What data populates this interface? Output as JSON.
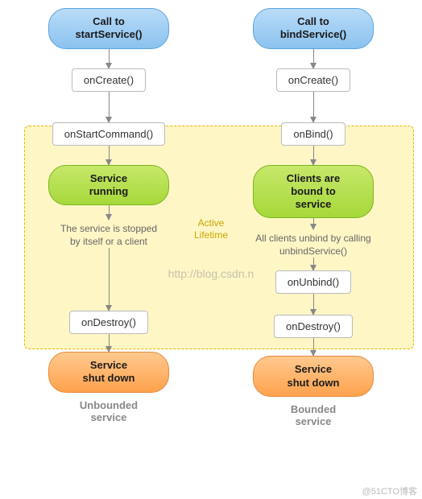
{
  "diagram": {
    "active_label": "Active\nLifetime",
    "watermark": "http://blog.csdn.n",
    "watermark2": "@51CTO博客",
    "left": {
      "start": "Call to\nstartService()",
      "on_create": "onCreate()",
      "on_start_cmd": "onStartCommand()",
      "running": "Service\nrunning",
      "stop_label": "The service is stopped\nby itself or a client",
      "on_destroy": "onDestroy()",
      "shutdown": "Service\nshut down",
      "caption": "Unbounded\nservice"
    },
    "right": {
      "start": "Call to\nbindService()",
      "on_create": "onCreate()",
      "on_bind": "onBind()",
      "bound": "Clients are\nbound to\nservice",
      "unbind_label": "All clients unbind by calling\nunbindService()",
      "on_unbind": "onUnbind()",
      "on_destroy": "onDestroy()",
      "shutdown": "Service\nshut down",
      "caption": "Bounded\nservice"
    }
  }
}
